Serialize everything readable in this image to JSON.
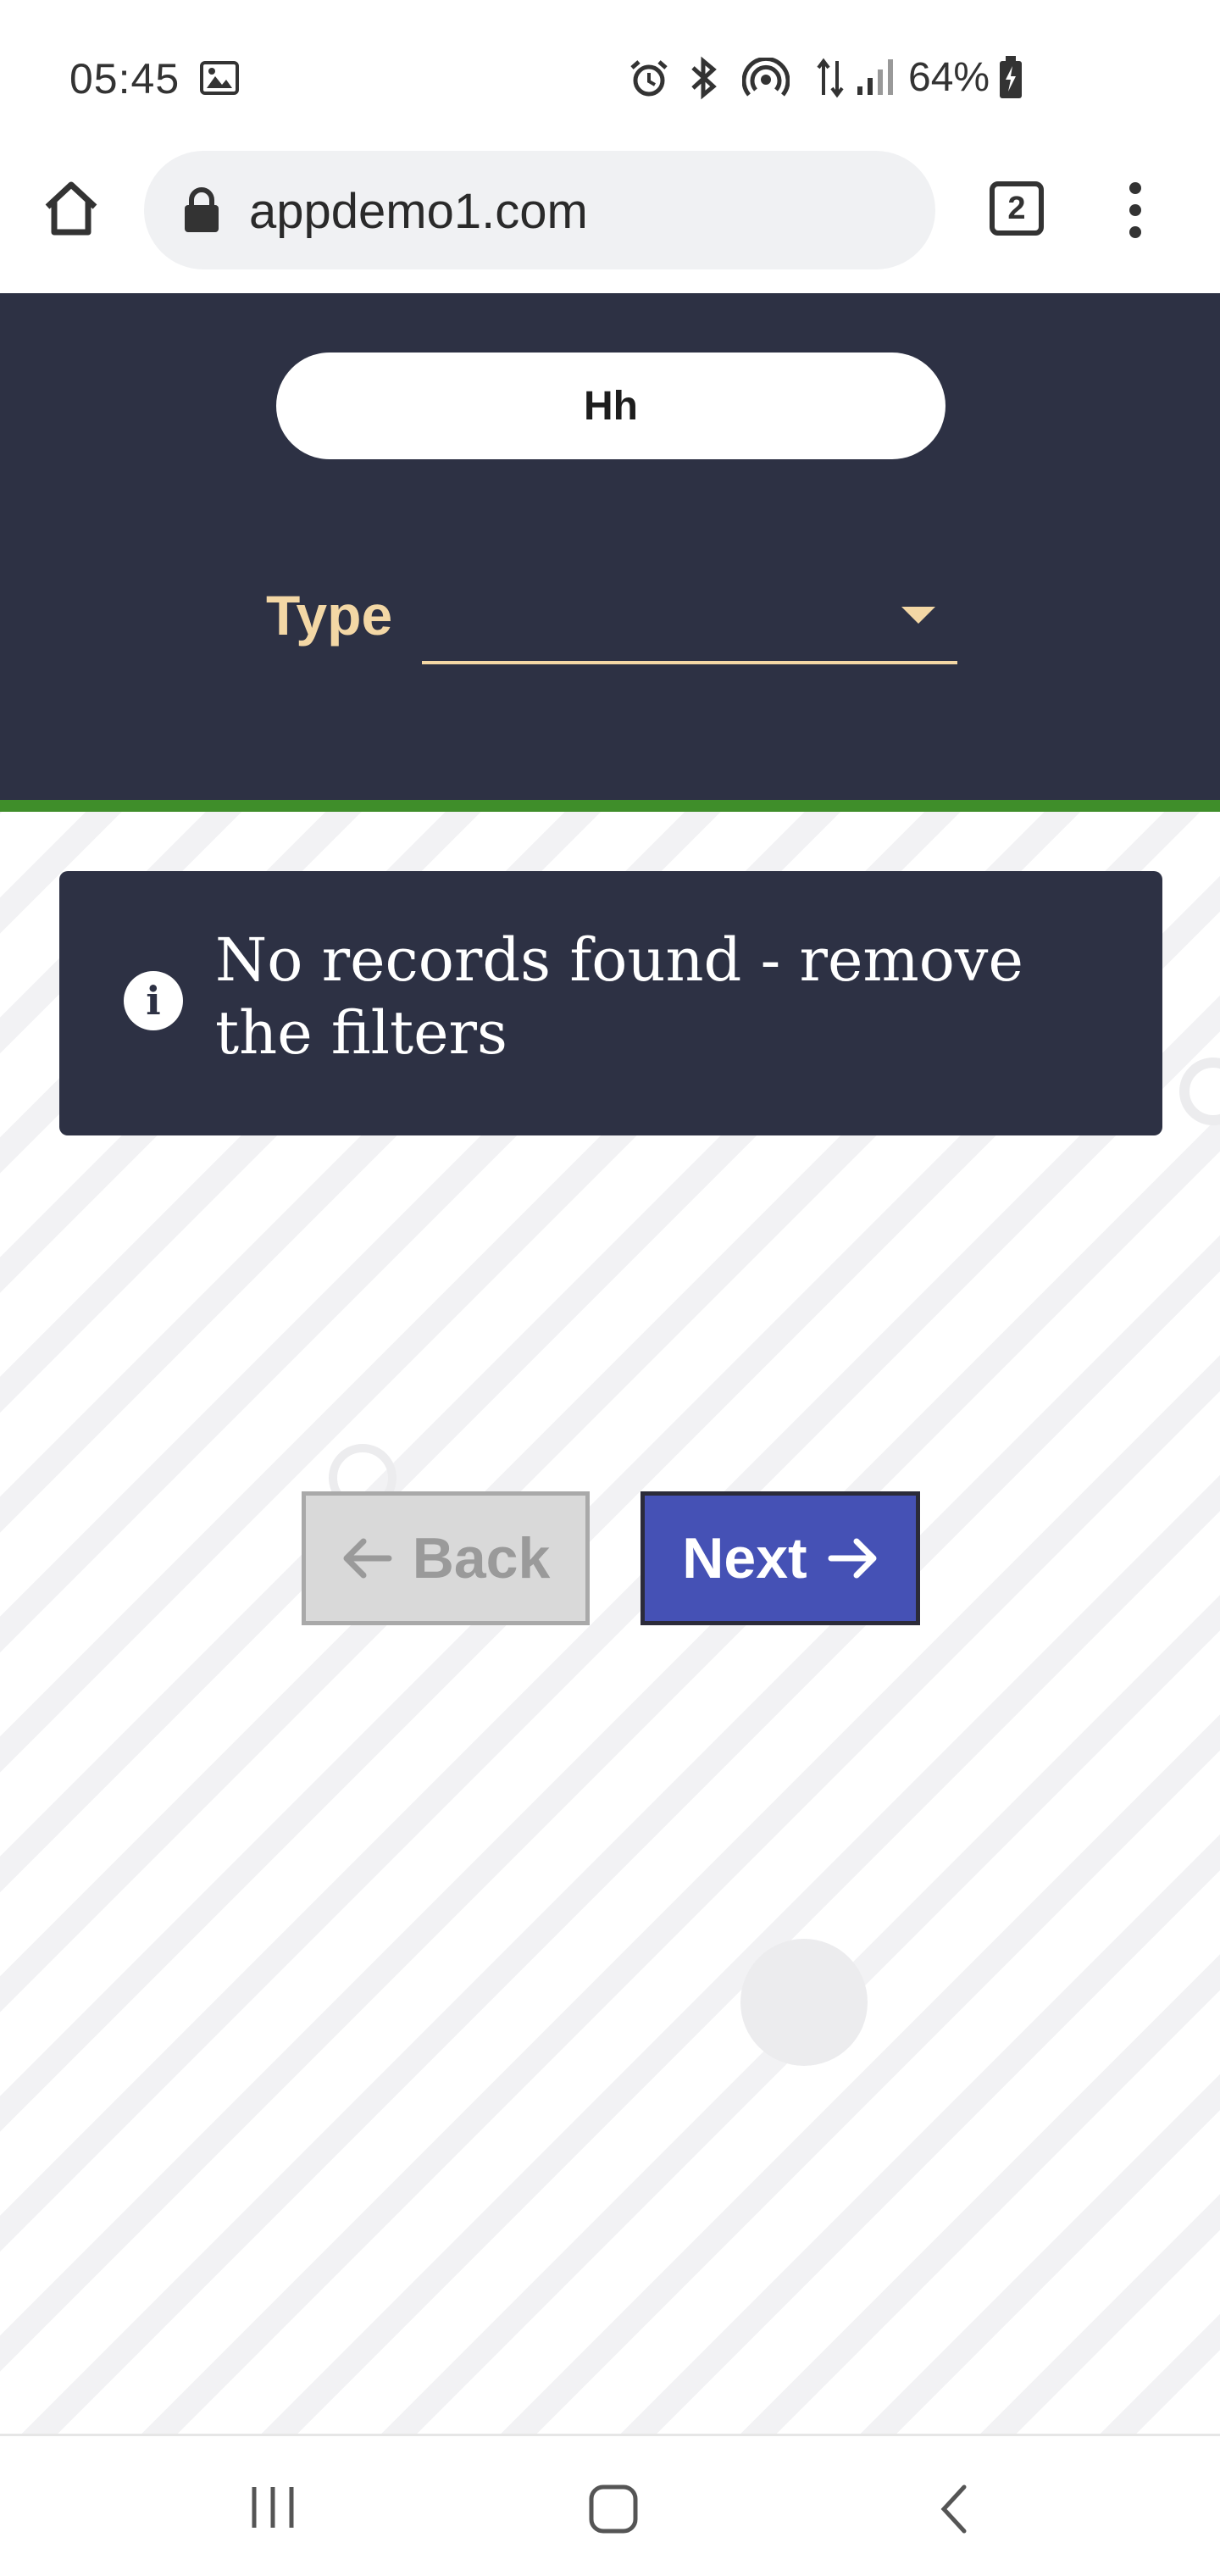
{
  "status_bar": {
    "time": "05:45",
    "battery": "64%",
    "icons": [
      "image-icon",
      "alarm-icon",
      "bluetooth-icon",
      "hotspot-icon",
      "data-arrows-icon",
      "signal-icon",
      "battery-charging-icon"
    ]
  },
  "browser": {
    "url": "appdemo1.com",
    "tab_count": "2",
    "icons": [
      "home-icon",
      "lock-icon",
      "tabs-icon",
      "more-vert-icon"
    ]
  },
  "header": {
    "name_value": "Hh",
    "type_label": "Type",
    "type_value": ""
  },
  "alert": {
    "icon": "info-icon",
    "text": "No records found - remove the filters"
  },
  "buttons": {
    "back_label": "Back",
    "next_label": "Next"
  },
  "nav": {
    "icons": [
      "recent-apps-icon",
      "home-icon",
      "back-icon"
    ]
  },
  "colors": {
    "header_bg": "#2d3144",
    "accent_green": "#3f8e2a",
    "label_gold": "#f3d7a5",
    "next_blue": "#4551b5"
  }
}
